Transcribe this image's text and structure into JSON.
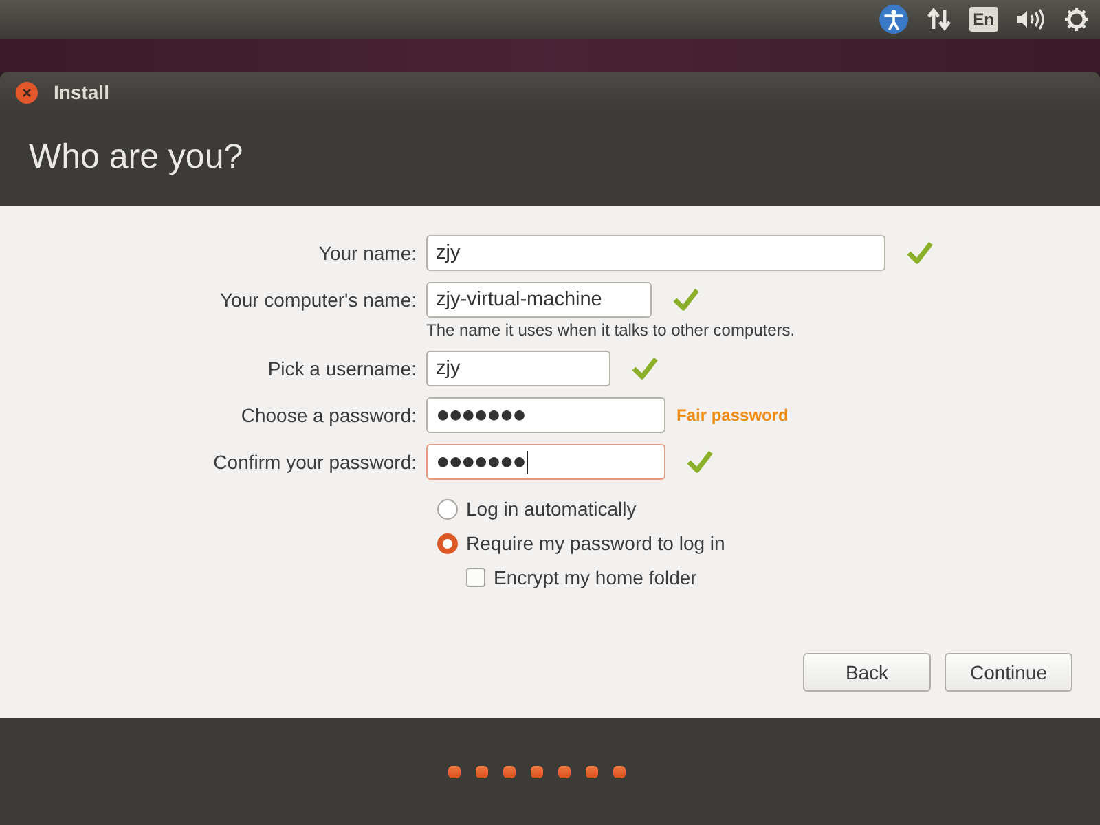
{
  "top_bar": {
    "keyboard_layout": "En"
  },
  "window": {
    "title": "Install"
  },
  "page": {
    "heading": "Who are you?"
  },
  "fields": [
    {
      "label": "Your name:",
      "value": "zjy",
      "kind": "text",
      "valid": true,
      "focused": false
    },
    {
      "label": "Your computer's name:",
      "value": "zjy-virtual-machine",
      "kind": "text",
      "valid": true,
      "focused": false,
      "hint": "The name it uses when it talks to other computers."
    },
    {
      "label": "Pick a username:",
      "value": "zjy",
      "kind": "text",
      "valid": true,
      "focused": false
    },
    {
      "label": "Choose a password:",
      "value": "●●●●●●●",
      "kind": "password",
      "valid": false,
      "focused": false,
      "strength": "Fair password"
    },
    {
      "label": "Confirm your password:",
      "value": "●●●●●●●",
      "kind": "password",
      "valid": true,
      "focused": true
    }
  ],
  "login_options": [
    {
      "label": "Log in automatically",
      "selected": false
    },
    {
      "label": "Require my password to log in",
      "selected": true
    }
  ],
  "encrypt_home": {
    "label": "Encrypt my home folder",
    "checked": false
  },
  "buttons": [
    {
      "label": "Back"
    },
    {
      "label": "Continue"
    }
  ],
  "slideshow_dots": [
    {
      "lit": true
    },
    {
      "lit": true
    },
    {
      "lit": true
    },
    {
      "lit": true
    },
    {
      "lit": true
    },
    {
      "lit": true
    },
    {
      "lit": true
    }
  ]
}
